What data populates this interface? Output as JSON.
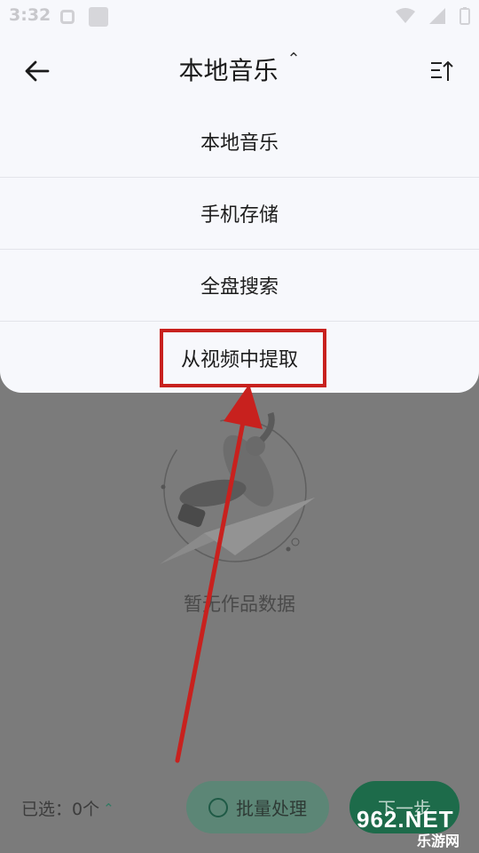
{
  "status_bar": {
    "time": "3:32"
  },
  "header": {
    "title": "本地音乐"
  },
  "menu": {
    "items": [
      {
        "label": "本地音乐"
      },
      {
        "label": "手机存储"
      },
      {
        "label": "全盘搜索"
      },
      {
        "label": "从视频中提取"
      }
    ]
  },
  "empty_state": {
    "text": "暂无作品数据"
  },
  "bottom_bar": {
    "selected_label": "已选：0个",
    "batch_label": "批量处理",
    "next_label": "下一步"
  },
  "watermark": {
    "number": "962.NET",
    "sub": "乐游网"
  },
  "colors": {
    "accent_green": "#1d6b4a",
    "highlight_red": "#c8211e"
  }
}
